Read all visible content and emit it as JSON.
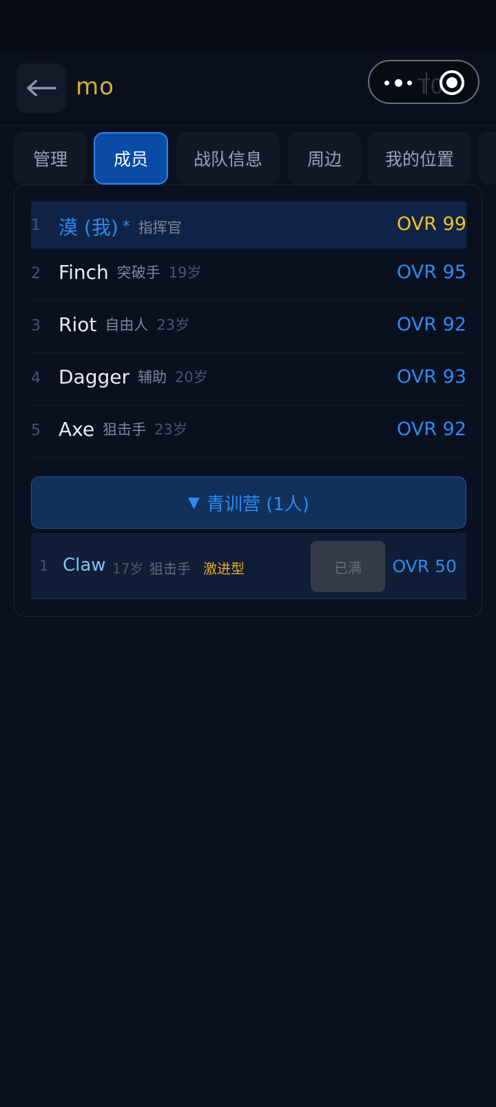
{
  "header": {
    "title": "mo",
    "back_icon": "arrow-left-icon",
    "capsule_ghost_text": "T0"
  },
  "tabs": [
    {
      "label": "管理",
      "active": false
    },
    {
      "label": "成员",
      "active": true
    },
    {
      "label": "战队信息",
      "active": false
    },
    {
      "label": "周边",
      "active": false
    },
    {
      "label": "我的位置",
      "active": false
    }
  ],
  "members": [
    {
      "index": "1",
      "name": "漠 (我)",
      "star": "*",
      "role": "指挥官",
      "age": "",
      "ovr": "OVR 99",
      "is_me": true
    },
    {
      "index": "2",
      "name": "Finch",
      "star": "",
      "role": "突破手",
      "age": "19岁",
      "ovr": "OVR 95",
      "is_me": false
    },
    {
      "index": "3",
      "name": "Riot",
      "star": "",
      "role": "自由人",
      "age": "23岁",
      "ovr": "OVR 92",
      "is_me": false
    },
    {
      "index": "4",
      "name": "Dagger",
      "star": "",
      "role": "辅助",
      "age": "20岁",
      "ovr": "OVR 93",
      "is_me": false
    },
    {
      "index": "5",
      "name": "Axe",
      "star": "",
      "role": "狙击手",
      "age": "23岁",
      "ovr": "OVR 92",
      "is_me": false
    }
  ],
  "academy": {
    "toggle_icon": "▼",
    "label": "青训营 (1人)",
    "trainees": [
      {
        "index": "1",
        "name": "Claw",
        "age": "17岁",
        "role": "狙击手",
        "trait": "激进型",
        "action": "已满",
        "ovr": "OVR 50"
      }
    ]
  },
  "colors": {
    "accent_blue": "#2c8cf0",
    "gold": "#f4c21f",
    "title_gold": "#d9b03a",
    "trait_orange": "#f0a830",
    "background": "#0b1020"
  }
}
